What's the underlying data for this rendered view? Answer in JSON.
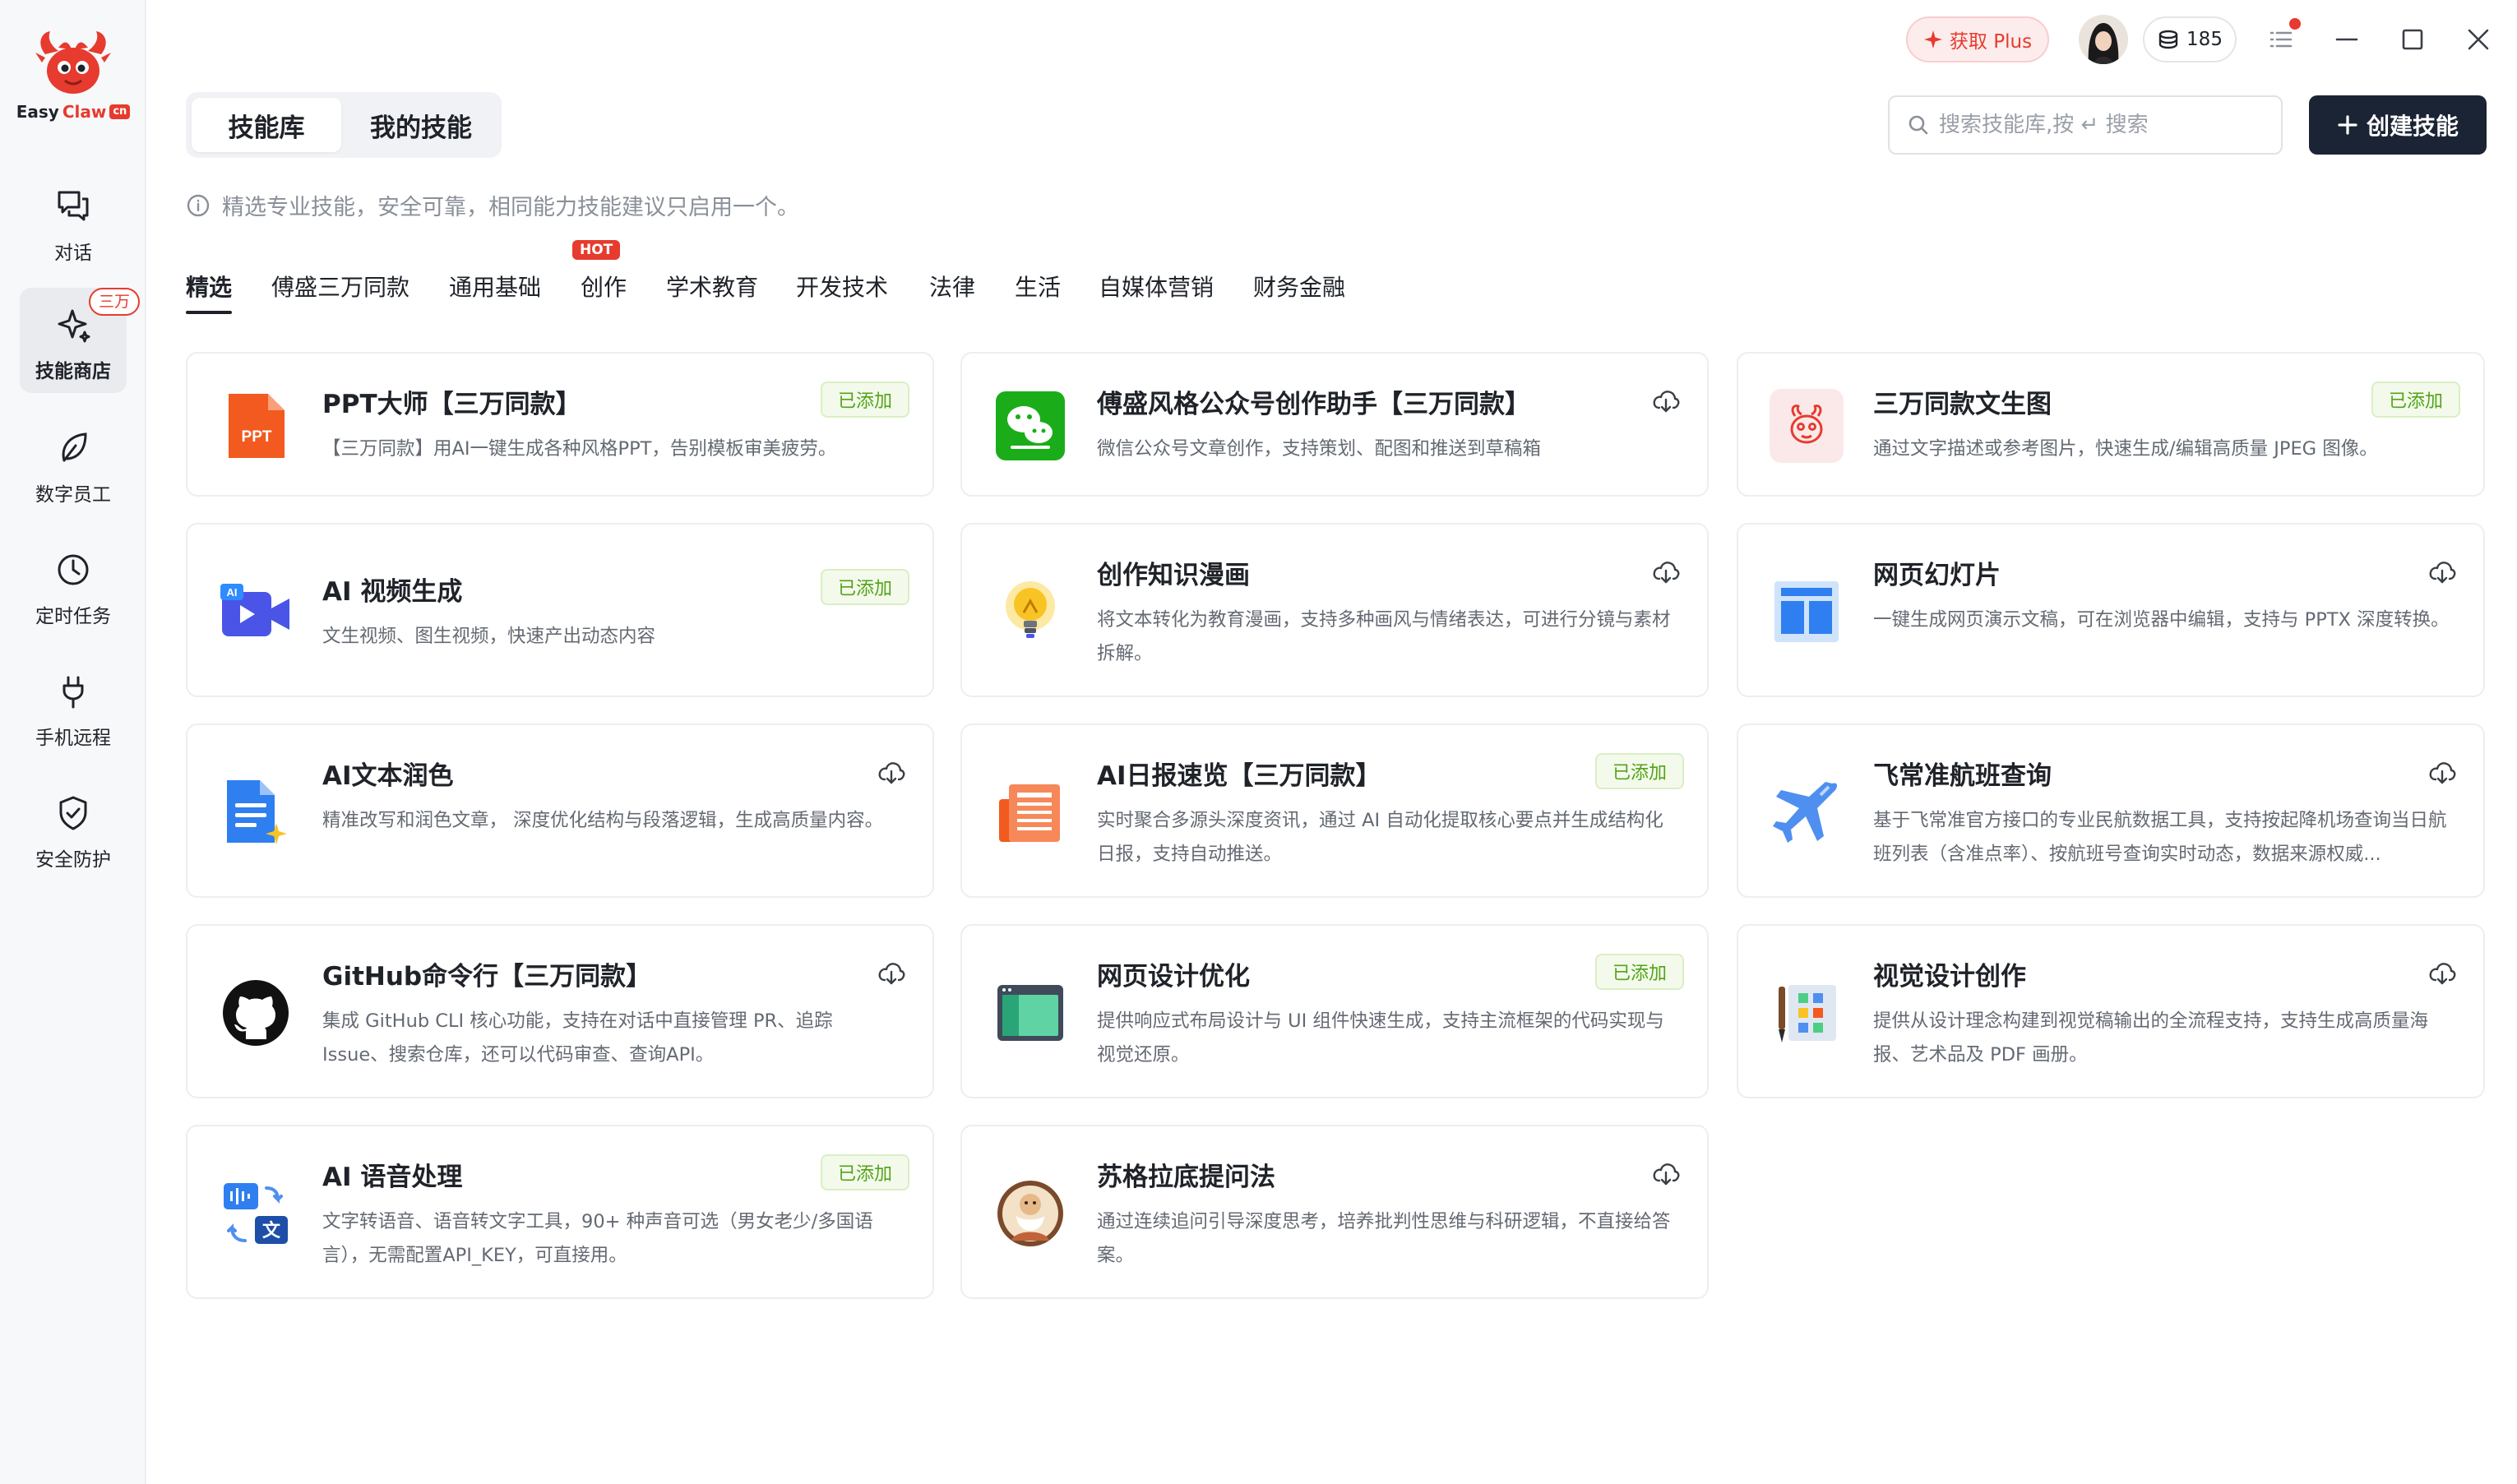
{
  "app": {
    "logo_text_1": "Easy",
    "logo_text_2": "Claw",
    "logo_badge": "cn"
  },
  "sidebar": {
    "items": [
      {
        "label": "对话",
        "icon": "chat-icon"
      },
      {
        "label": "技能商店",
        "icon": "sparkle-icon",
        "tag": "三万",
        "active": true
      },
      {
        "label": "数字员工",
        "icon": "leaf-icon"
      },
      {
        "label": "定时任务",
        "icon": "clock-icon"
      },
      {
        "label": "手机远程",
        "icon": "plug-icon"
      },
      {
        "label": "安全防护",
        "icon": "shield-check-icon"
      }
    ]
  },
  "topbar": {
    "plus_label": "获取 Plus",
    "credits": "185"
  },
  "header": {
    "tabs": [
      {
        "label": "技能库",
        "active": true
      },
      {
        "label": "我的技能",
        "active": false
      }
    ],
    "search_placeholder": "搜索技能库,按 ↵ 搜索",
    "create_label": "创建技能",
    "hint": "精选专业技能，安全可靠，相同能力技能建议只启用一个。"
  },
  "categories": {
    "items": [
      {
        "label": "精选",
        "active": true
      },
      {
        "label": "傅盛三万同款",
        "hot": true
      },
      {
        "label": "通用基础"
      },
      {
        "label": "创作"
      },
      {
        "label": "学术教育"
      },
      {
        "label": "开发技术"
      },
      {
        "label": "法律"
      },
      {
        "label": "生活"
      },
      {
        "label": "自媒体营销"
      },
      {
        "label": "财务金融"
      }
    ],
    "hot_label": "HOT"
  },
  "labels": {
    "added": "已添加"
  },
  "skills": [
    {
      "title": "PPT大师【三万同款】",
      "desc": "【三万同款】用AI一键生成各种风格PPT，告别模板审美疲劳。",
      "added": true,
      "icon": "ppt-icon"
    },
    {
      "title": "傅盛风格公众号创作助手【三万同款】",
      "desc": "微信公众号文章创作，支持策划、配图和推送到草稿箱",
      "added": false,
      "icon": "wechat-icon"
    },
    {
      "title": "三万同款文生图",
      "desc": "通过文字描述或参考图片，快速生成/编辑高质量 JPEG 图像。",
      "added": true,
      "icon": "mascot-icon"
    },
    {
      "title": "AI 视频生成",
      "desc": "文生视频、图生视频，快速产出动态内容",
      "added": true,
      "icon": "ai-video-icon"
    },
    {
      "title": "创作知识漫画",
      "desc": "将文本转化为教育漫画，支持多种画风与情绪表达，可进行分镜与素材拆解。",
      "added": false,
      "icon": "lightbulb-icon"
    },
    {
      "title": "网页幻灯片",
      "desc": "一键生成网页演示文稿，可在浏览器中编辑，支持与 PPTX 深度转换。",
      "added": false,
      "icon": "web-slides-icon"
    },
    {
      "title": "AI文本润色",
      "desc": "精准改写和润色文章， 深度优化结构与段落逻辑，生成高质量内容。",
      "added": false,
      "icon": "document-sparkle-icon"
    },
    {
      "title": "AI日报速览【三万同款】",
      "desc": "实时聚合多源头深度资讯，通过 AI 自动化提取核心要点并生成结构化日报，支持自动推送。",
      "added": true,
      "icon": "newspaper-icon"
    },
    {
      "title": "飞常准航班查询",
      "desc": "基于飞常准官方接口的专业民航数据工具，支持按起降机场查询当日航班列表（含准点率）、按航班号查询实时动态，数据来源权威...",
      "added": false,
      "icon": "airplane-icon"
    },
    {
      "title": "GitHub命令行【三万同款】",
      "desc": "集成 GitHub CLI 核心功能，支持在对话中直接管理 PR、追踪 Issue、搜索仓库，还可以代码审查、查询API。",
      "added": false,
      "icon": "github-icon"
    },
    {
      "title": "网页设计优化",
      "desc": "提供响应式布局设计与 UI 组件快速生成，支持主流框架的代码实现与视觉还原。",
      "added": true,
      "icon": "web-window-icon"
    },
    {
      "title": "视觉设计创作",
      "desc": "提供从设计理念构建到视觉稿输出的全流程支持，支持生成高质量海报、艺术品及 PDF 画册。",
      "added": false,
      "icon": "palette-icon"
    },
    {
      "title": "AI 语音处理",
      "desc": "文字转语音、语音转文字工具，90+ 种声音可选（男女老少/多国语言），无需配置API_KEY，可直接用。",
      "added": true,
      "icon": "speech-translate-icon"
    },
    {
      "title": "苏格拉底提问法",
      "desc": "通过连续追问引导深度思考，培养批判性思维与科研逻辑，不直接给答案。",
      "added": false,
      "icon": "socrates-icon"
    }
  ],
  "colors": {
    "accent_red": "#e63b2e",
    "dark_button": "#1b2434",
    "added_green": "#53a318"
  }
}
